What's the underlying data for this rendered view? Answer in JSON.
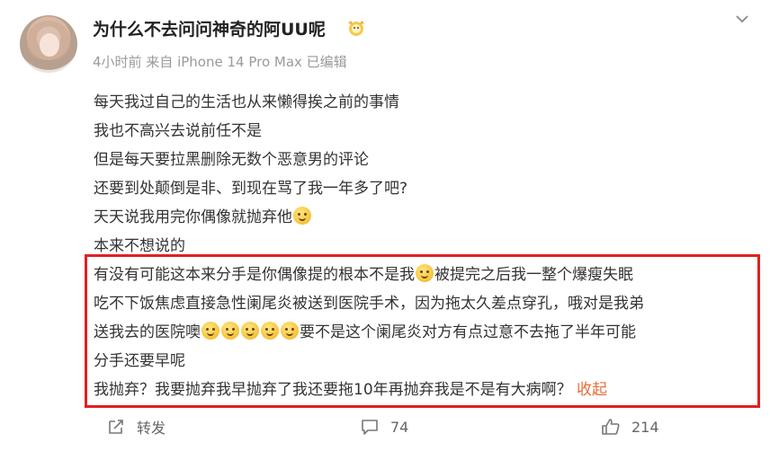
{
  "post": {
    "username": "为什么不去问问神奇的阿UU呢",
    "meta": "4小时前 来自 iPhone 14 Pro Max 已编辑",
    "lines": [
      "每天我过自己的生活也从来懒得挨之前的事情",
      "我也不高兴去说前任不是",
      "但是每天要拉黑删除无数个恶意男的评论",
      "还要到处颠倒是非、到现在骂了我一年多了吧?",
      "天天说我用完你偶像就抛弃他",
      "本来不想说的",
      "有没有可能这本来分手是你偶像提的根本不是我",
      "被提完之后我一整个爆瘦失眠",
      "吃不下饭焦虑直接急性阑尾炎被送到医院手术，因为拖太久差点穿孔，哦对是我弟",
      "送我去的医院噢",
      "要不是这个阑尾炎对方有点过意不去拖了半年可能",
      "分手还要早呢",
      "我抛弃？我要抛弃我早抛弃了我还要拖10年再抛弃我是不是有大病啊？",
      "收起"
    ]
  },
  "actions": {
    "repost_label": "转发",
    "comment_count": "74",
    "like_count": "214"
  },
  "icons": {
    "emoji": "smile-emoji-icon",
    "badge": "vip-badge-icon",
    "chevron": "chevron-down-icon",
    "repost": "repost-icon",
    "comment": "comment-icon",
    "like": "thumbs-up-icon"
  },
  "colors": {
    "highlight_border": "#e02020",
    "collapse_link": "#e86b3a",
    "meta_text": "#9a9a9a"
  }
}
